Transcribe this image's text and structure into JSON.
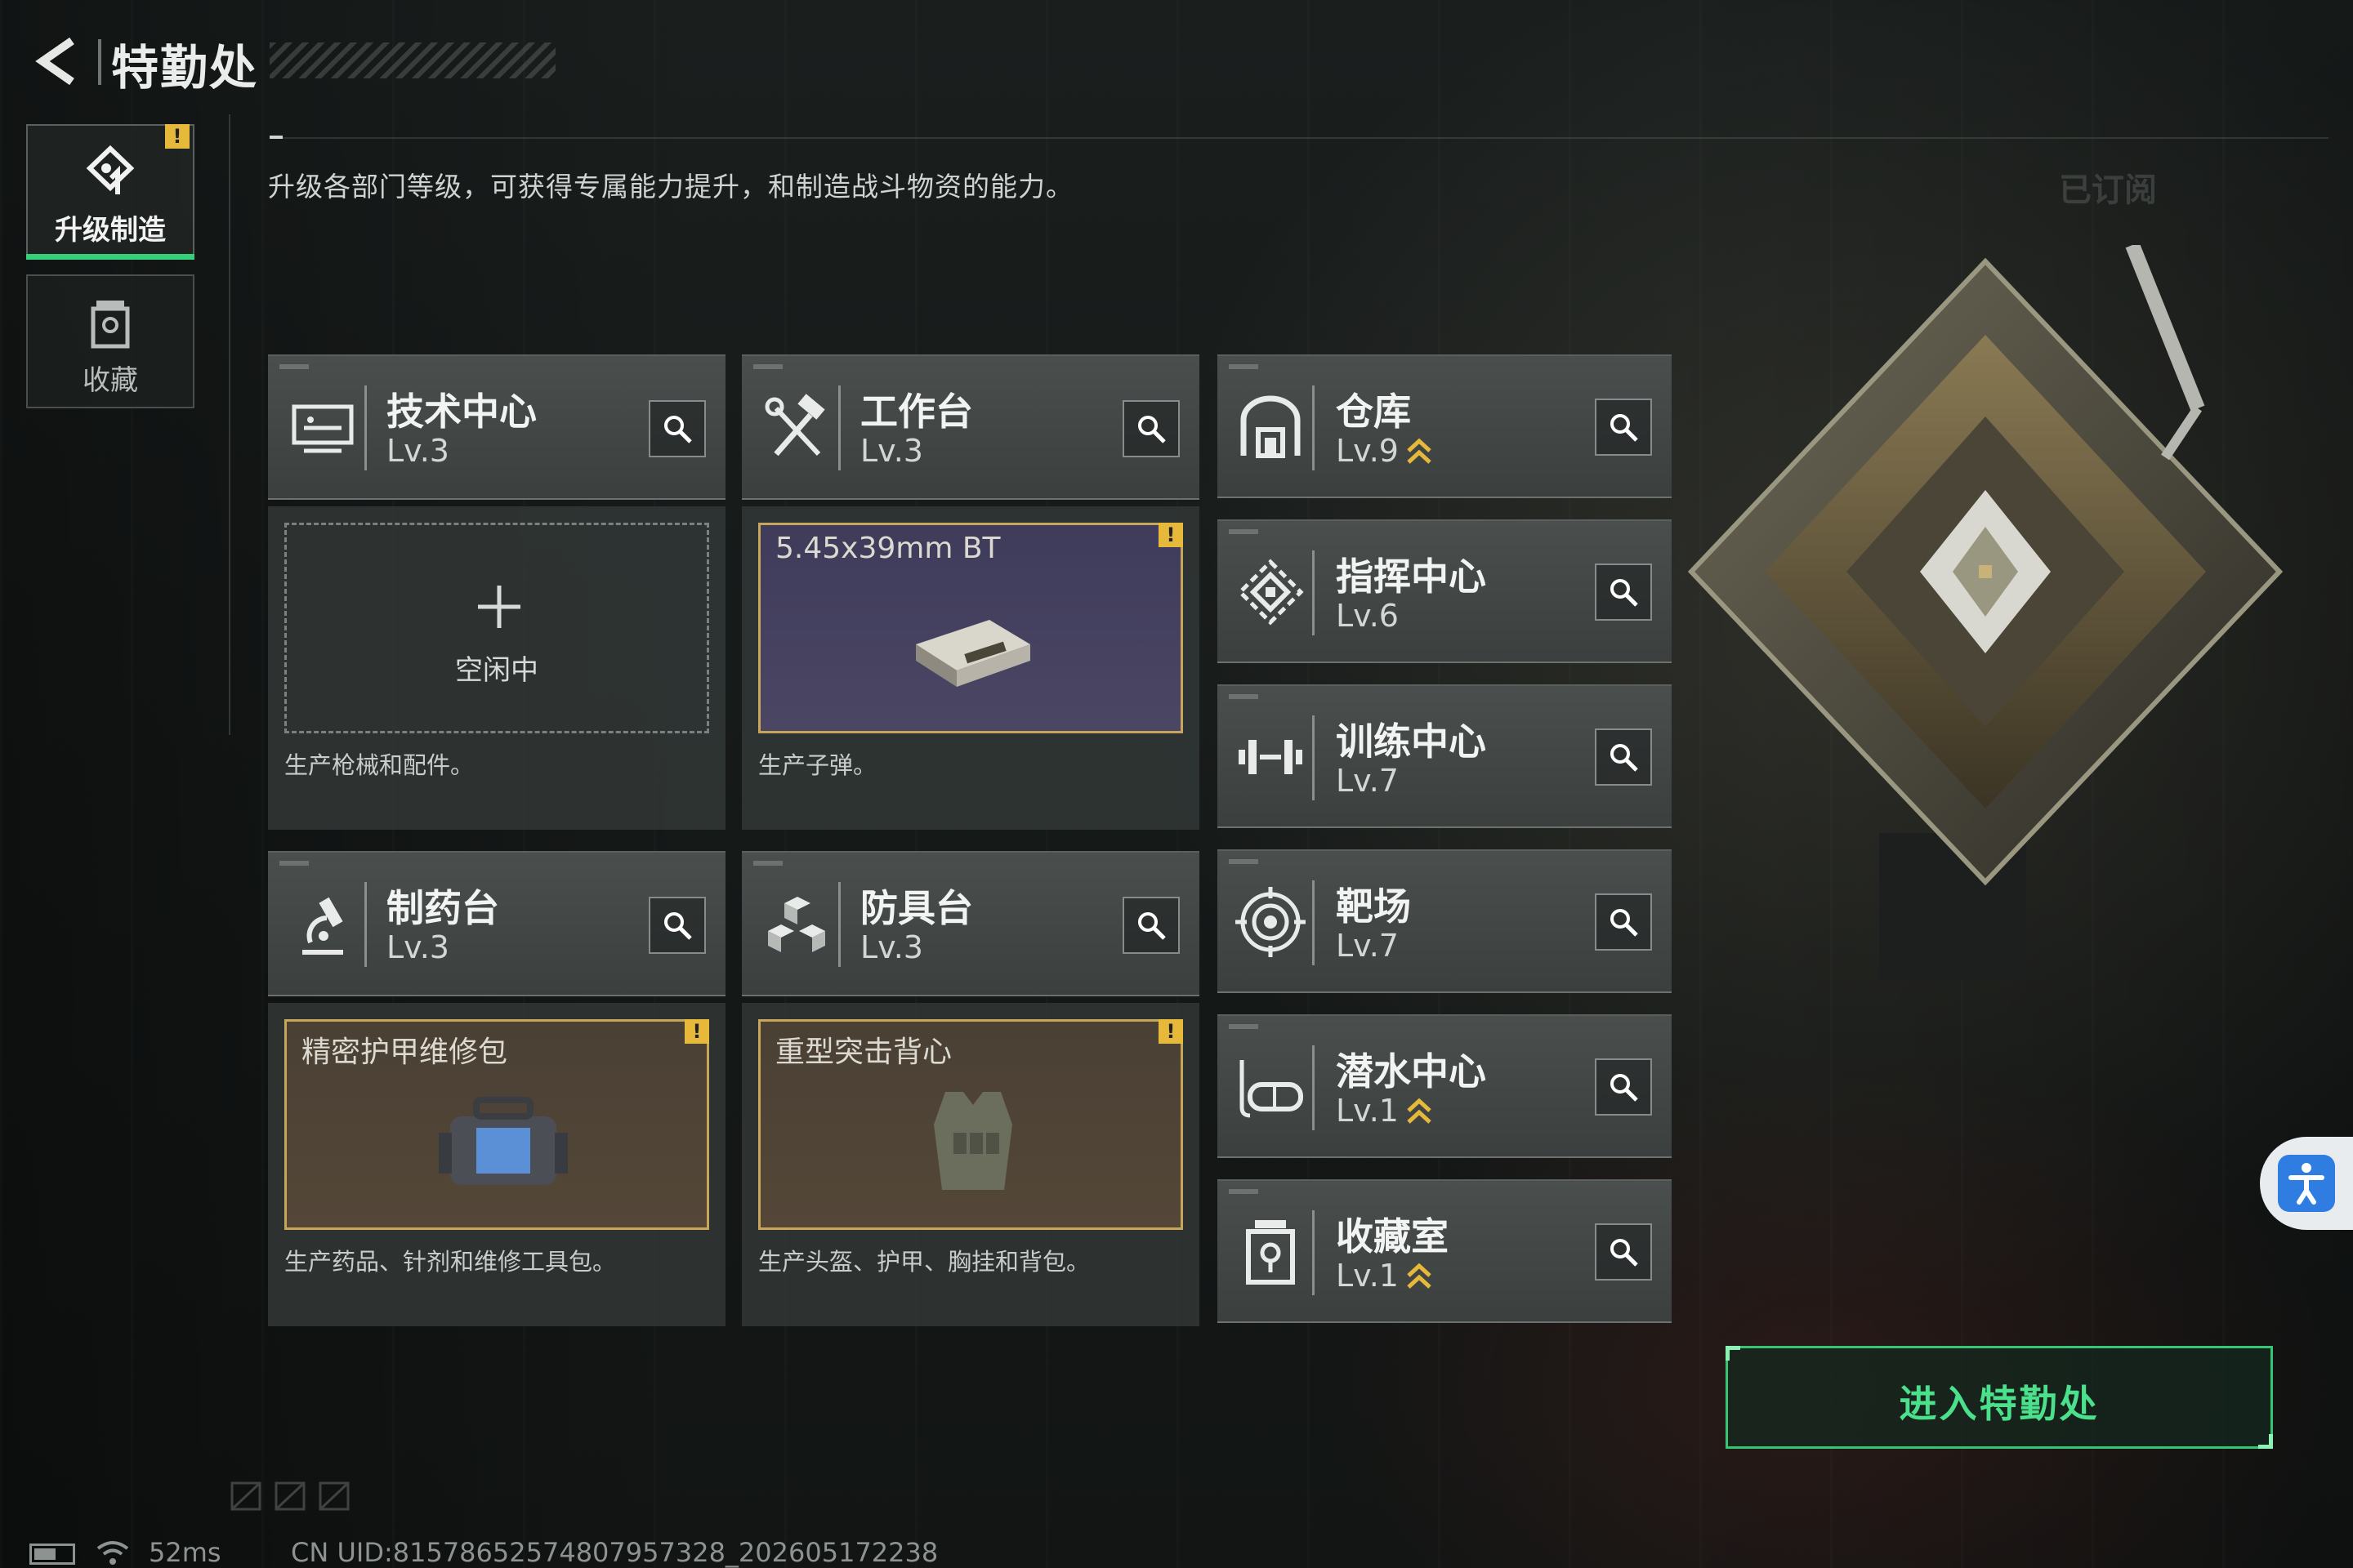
{
  "header": {
    "title": "特勤处",
    "back_icon": "back-arrow-icon"
  },
  "sidebar": {
    "tabs": [
      {
        "label": "升级制造",
        "icon": "upgrade-craft-icon",
        "active": true,
        "alert": "!"
      },
      {
        "label": "收藏",
        "icon": "collection-icon",
        "active": false
      }
    ]
  },
  "description": "升级各部门等级，可获得专属能力提升，和制造战斗物资的能力。",
  "subscribed_label": "已订阅",
  "departments": [
    {
      "name": "技术中心",
      "level": "Lv.3",
      "icon": "monitor-icon",
      "slot": {
        "state": "empty",
        "label": "空闲中"
      },
      "desc": "生产枪械和配件。"
    },
    {
      "name": "工作台",
      "level": "Lv.3",
      "icon": "hammer-wrench-icon",
      "slot": {
        "state": "producing",
        "item": "5.45x39mm BT",
        "alert": "!"
      },
      "desc": "生产子弹。"
    },
    {
      "name": "制药台",
      "level": "Lv.3",
      "icon": "microscope-icon",
      "slot": {
        "state": "producing",
        "item": "精密护甲维修包",
        "alert": "!"
      },
      "desc": "生产药品、针剂和维修工具包。"
    },
    {
      "name": "防具台",
      "level": "Lv.3",
      "icon": "armor-blocks-icon",
      "slot": {
        "state": "producing",
        "item": "重型突击背心",
        "alert": "!"
      },
      "desc": "生产头盔、护甲、胸挂和背包。"
    }
  ],
  "facilities": [
    {
      "name": "仓库",
      "level": "Lv.9",
      "icon": "warehouse-icon",
      "upgradable": true
    },
    {
      "name": "指挥中心",
      "level": "Lv.6",
      "icon": "command-center-icon",
      "upgradable": false
    },
    {
      "name": "训练中心",
      "level": "Lv.7",
      "icon": "dumbbell-icon",
      "upgradable": false
    },
    {
      "name": "靶场",
      "level": "Lv.7",
      "icon": "target-icon",
      "upgradable": false
    },
    {
      "name": "潜水中心",
      "level": "Lv.1",
      "icon": "diving-mask-icon",
      "upgradable": true
    },
    {
      "name": "收藏室",
      "level": "Lv.1",
      "icon": "collection-room-icon",
      "upgradable": true
    }
  ],
  "enter_button": "进入特勤处",
  "status": {
    "ping": "52ms",
    "uid": "CN UID:8157865257480795732​8_202605172238"
  },
  "colors": {
    "accent_green": "#37d07a",
    "alert_yellow": "#e7b93a",
    "slot_border_gold": "#c7a55a",
    "upgrade_arrow": "#e7b93a"
  }
}
